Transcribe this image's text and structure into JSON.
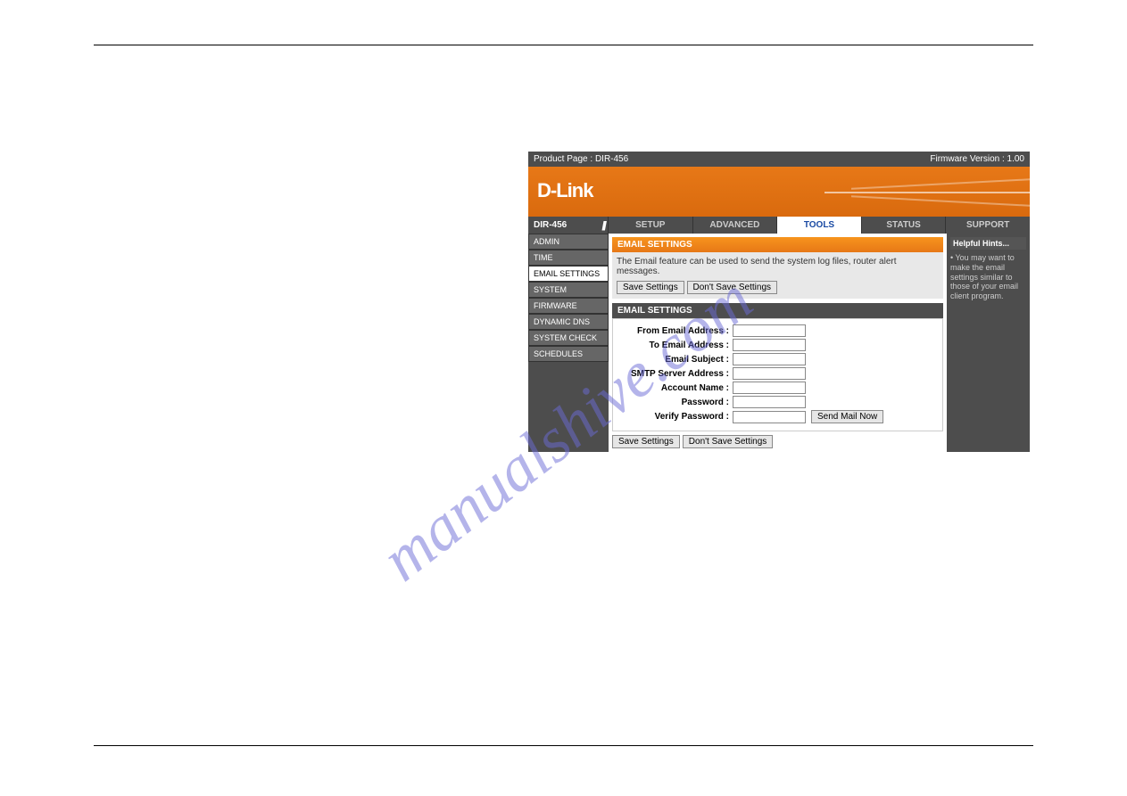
{
  "topbar": {
    "product_page_label": "Product Page :",
    "product_page_link": "DIR-456",
    "fw_label": "Firmware Version : 1.00"
  },
  "banner": {
    "logo_text": "D-Link"
  },
  "nav": {
    "model": "DIR-456",
    "items": [
      {
        "label": "SETUP"
      },
      {
        "label": "ADVANCED"
      },
      {
        "label": "TOOLS"
      },
      {
        "label": "STATUS"
      },
      {
        "label": "SUPPORT"
      }
    ]
  },
  "sidebar": {
    "items": [
      {
        "label": "ADMIN"
      },
      {
        "label": "TIME"
      },
      {
        "label": "EMAIL SETTINGS"
      },
      {
        "label": "SYSTEM"
      },
      {
        "label": "FIRMWARE"
      },
      {
        "label": "DYNAMIC DNS"
      },
      {
        "label": "SYSTEM CHECK"
      },
      {
        "label": "SCHEDULES"
      }
    ]
  },
  "content": {
    "section1_title": "EMAIL SETTINGS",
    "section1_desc": "The Email feature can be used to send the system log files, router alert messages.",
    "save_btn": "Save Settings",
    "dont_save_btn": "Don't Save Settings",
    "section2_title": "EMAIL SETTINGS",
    "form": {
      "from_label": "From Email Address  :",
      "to_label": "To Email Address  :",
      "subject_label": "Email Subject  :",
      "smtp_label": "SMTP Server Address  :",
      "account_label": "Account Name  :",
      "password_label": "Password  :",
      "verify_label": "Verify Password  :",
      "send_btn": "Send Mail Now"
    }
  },
  "hints": {
    "title": "Helpful Hints...",
    "text": "• You may want to make the email settings similar to those of your email client program."
  },
  "watermark": "manualshive.com"
}
